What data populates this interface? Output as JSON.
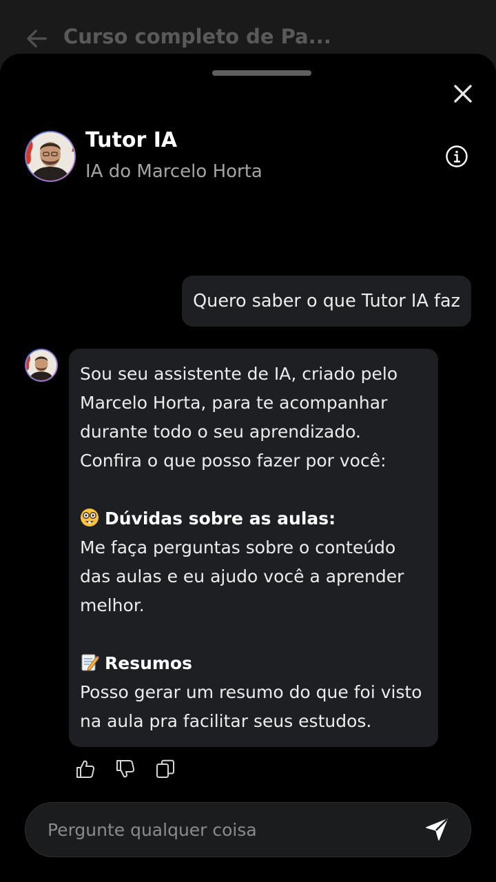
{
  "background_header": {
    "title": "Curso completo de Pa..."
  },
  "tutor": {
    "name": "Tutor IA",
    "subtitle": "IA do Marcelo Horta"
  },
  "messages": {
    "user": "Quero saber o que Tutor IA faz",
    "ai": {
      "intro": [
        "Sou seu assistente de IA, criado pelo",
        "Marcelo Horta, para te acompanhar",
        "durante todo o seu aprendizado.",
        "Confira o que posso fazer por você:"
      ],
      "section1": {
        "icon": "nerd-face-icon",
        "heading": "Dúvidas sobre as aulas:",
        "lines": [
          "Me faça perguntas sobre o conteúdo",
          "das aulas e eu ajudo você a aprender",
          "melhor."
        ]
      },
      "section2": {
        "icon": "memo-icon",
        "heading": "Resumos",
        "lines": [
          "Posso gerar um resumo do que foi visto",
          "na aula pra facilitar seus estudos."
        ]
      }
    }
  },
  "actions": [
    "thumbs-up-icon",
    "thumbs-down-icon",
    "copy-icon"
  ],
  "composer": {
    "placeholder": "Pergunte qualquer coisa"
  },
  "colors": {
    "sheet_background": "#000000",
    "bubble_background": "#1e1f22",
    "secondary_text": "#a5a5a5"
  }
}
